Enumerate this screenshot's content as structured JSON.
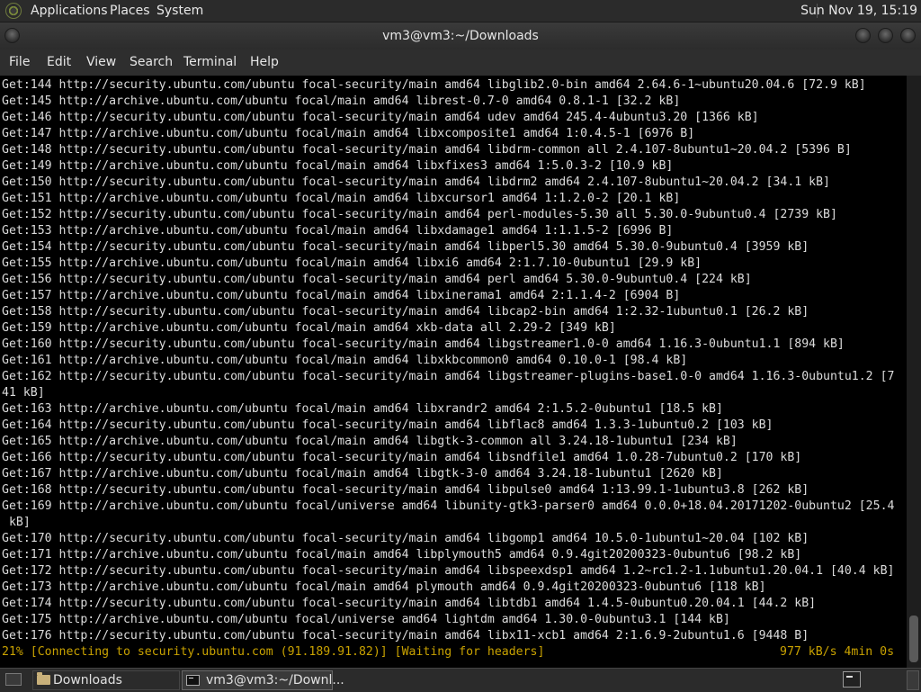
{
  "top_panel": {
    "menus": [
      "Applications",
      "Places",
      "System"
    ],
    "clock": "Sun Nov 19, 15:19"
  },
  "window": {
    "title": "vm3@vm3:~/Downloads"
  },
  "menubar": {
    "items": [
      "File",
      "Edit",
      "View",
      "Search",
      "Terminal",
      "Help"
    ]
  },
  "terminal": {
    "lines": [
      "Get:144 http://security.ubuntu.com/ubuntu focal-security/main amd64 libglib2.0-bin amd64 2.64.6-1~ubuntu20.04.6 [72.9 kB]",
      "Get:145 http://archive.ubuntu.com/ubuntu focal/main amd64 librest-0.7-0 amd64 0.8.1-1 [32.2 kB]",
      "Get:146 http://security.ubuntu.com/ubuntu focal-security/main amd64 udev amd64 245.4-4ubuntu3.20 [1366 kB]",
      "Get:147 http://archive.ubuntu.com/ubuntu focal/main amd64 libxcomposite1 amd64 1:0.4.5-1 [6976 B]",
      "Get:148 http://security.ubuntu.com/ubuntu focal-security/main amd64 libdrm-common all 2.4.107-8ubuntu1~20.04.2 [5396 B]",
      "Get:149 http://archive.ubuntu.com/ubuntu focal/main amd64 libxfixes3 amd64 1:5.0.3-2 [10.9 kB]",
      "Get:150 http://security.ubuntu.com/ubuntu focal-security/main amd64 libdrm2 amd64 2.4.107-8ubuntu1~20.04.2 [34.1 kB]",
      "Get:151 http://archive.ubuntu.com/ubuntu focal/main amd64 libxcursor1 amd64 1:1.2.0-2 [20.1 kB]",
      "Get:152 http://security.ubuntu.com/ubuntu focal-security/main amd64 perl-modules-5.30 all 5.30.0-9ubuntu0.4 [2739 kB]",
      "Get:153 http://archive.ubuntu.com/ubuntu focal/main amd64 libxdamage1 amd64 1:1.1.5-2 [6996 B]",
      "Get:154 http://security.ubuntu.com/ubuntu focal-security/main amd64 libperl5.30 amd64 5.30.0-9ubuntu0.4 [3959 kB]",
      "Get:155 http://archive.ubuntu.com/ubuntu focal/main amd64 libxi6 amd64 2:1.7.10-0ubuntu1 [29.9 kB]",
      "Get:156 http://security.ubuntu.com/ubuntu focal-security/main amd64 perl amd64 5.30.0-9ubuntu0.4 [224 kB]",
      "Get:157 http://archive.ubuntu.com/ubuntu focal/main amd64 libxinerama1 amd64 2:1.1.4-2 [6904 B]",
      "Get:158 http://security.ubuntu.com/ubuntu focal-security/main amd64 libcap2-bin amd64 1:2.32-1ubuntu0.1 [26.2 kB]",
      "Get:159 http://archive.ubuntu.com/ubuntu focal/main amd64 xkb-data all 2.29-2 [349 kB]",
      "Get:160 http://security.ubuntu.com/ubuntu focal-security/main amd64 libgstreamer1.0-0 amd64 1.16.3-0ubuntu1.1 [894 kB]",
      "Get:161 http://archive.ubuntu.com/ubuntu focal/main amd64 libxkbcommon0 amd64 0.10.0-1 [98.4 kB]",
      "Get:162 http://security.ubuntu.com/ubuntu focal-security/main amd64 libgstreamer-plugins-base1.0-0 amd64 1.16.3-0ubuntu1.2 [7",
      "41 kB]",
      "Get:163 http://archive.ubuntu.com/ubuntu focal/main amd64 libxrandr2 amd64 2:1.5.2-0ubuntu1 [18.5 kB]",
      "Get:164 http://security.ubuntu.com/ubuntu focal-security/main amd64 libflac8 amd64 1.3.3-1ubuntu0.2 [103 kB]",
      "Get:165 http://archive.ubuntu.com/ubuntu focal/main amd64 libgtk-3-common all 3.24.18-1ubuntu1 [234 kB]",
      "Get:166 http://security.ubuntu.com/ubuntu focal-security/main amd64 libsndfile1 amd64 1.0.28-7ubuntu0.2 [170 kB]",
      "Get:167 http://archive.ubuntu.com/ubuntu focal/main amd64 libgtk-3-0 amd64 3.24.18-1ubuntu1 [2620 kB]",
      "Get:168 http://security.ubuntu.com/ubuntu focal-security/main amd64 libpulse0 amd64 1:13.99.1-1ubuntu3.8 [262 kB]",
      "Get:169 http://archive.ubuntu.com/ubuntu focal/universe amd64 libunity-gtk3-parser0 amd64 0.0.0+18.04.20171202-0ubuntu2 [25.4",
      " kB]",
      "Get:170 http://security.ubuntu.com/ubuntu focal-security/main amd64 libgomp1 amd64 10.5.0-1ubuntu1~20.04 [102 kB]",
      "Get:171 http://archive.ubuntu.com/ubuntu focal/main amd64 libplymouth5 amd64 0.9.4git20200323-0ubuntu6 [98.2 kB]",
      "Get:172 http://security.ubuntu.com/ubuntu focal-security/main amd64 libspeexdsp1 amd64 1.2~rc1.2-1.1ubuntu1.20.04.1 [40.4 kB]",
      "Get:173 http://archive.ubuntu.com/ubuntu focal/main amd64 plymouth amd64 0.9.4git20200323-0ubuntu6 [118 kB]",
      "Get:174 http://security.ubuntu.com/ubuntu focal-security/main amd64 libtdb1 amd64 1.4.5-0ubuntu0.20.04.1 [44.2 kB]",
      "Get:175 http://archive.ubuntu.com/ubuntu focal/universe amd64 lightdm amd64 1.30.0-0ubuntu3.1 [144 kB]",
      "Get:176 http://security.ubuntu.com/ubuntu focal-security/main amd64 libx11-xcb1 amd64 2:1.6.9-2ubuntu1.6 [9448 B]"
    ],
    "status_left": "21% [Connecting to security.ubuntu.com (91.189.91.82)] [Waiting for headers]",
    "status_right": "977 kB/s 4min 0s"
  },
  "taskbar": {
    "tasks": [
      "Downloads",
      "vm3@vm3:~/Downl..."
    ]
  },
  "colors": {
    "status_text": "#c9a200",
    "terminal_bg": "#000000",
    "terminal_fg": "#dcdcdc"
  }
}
